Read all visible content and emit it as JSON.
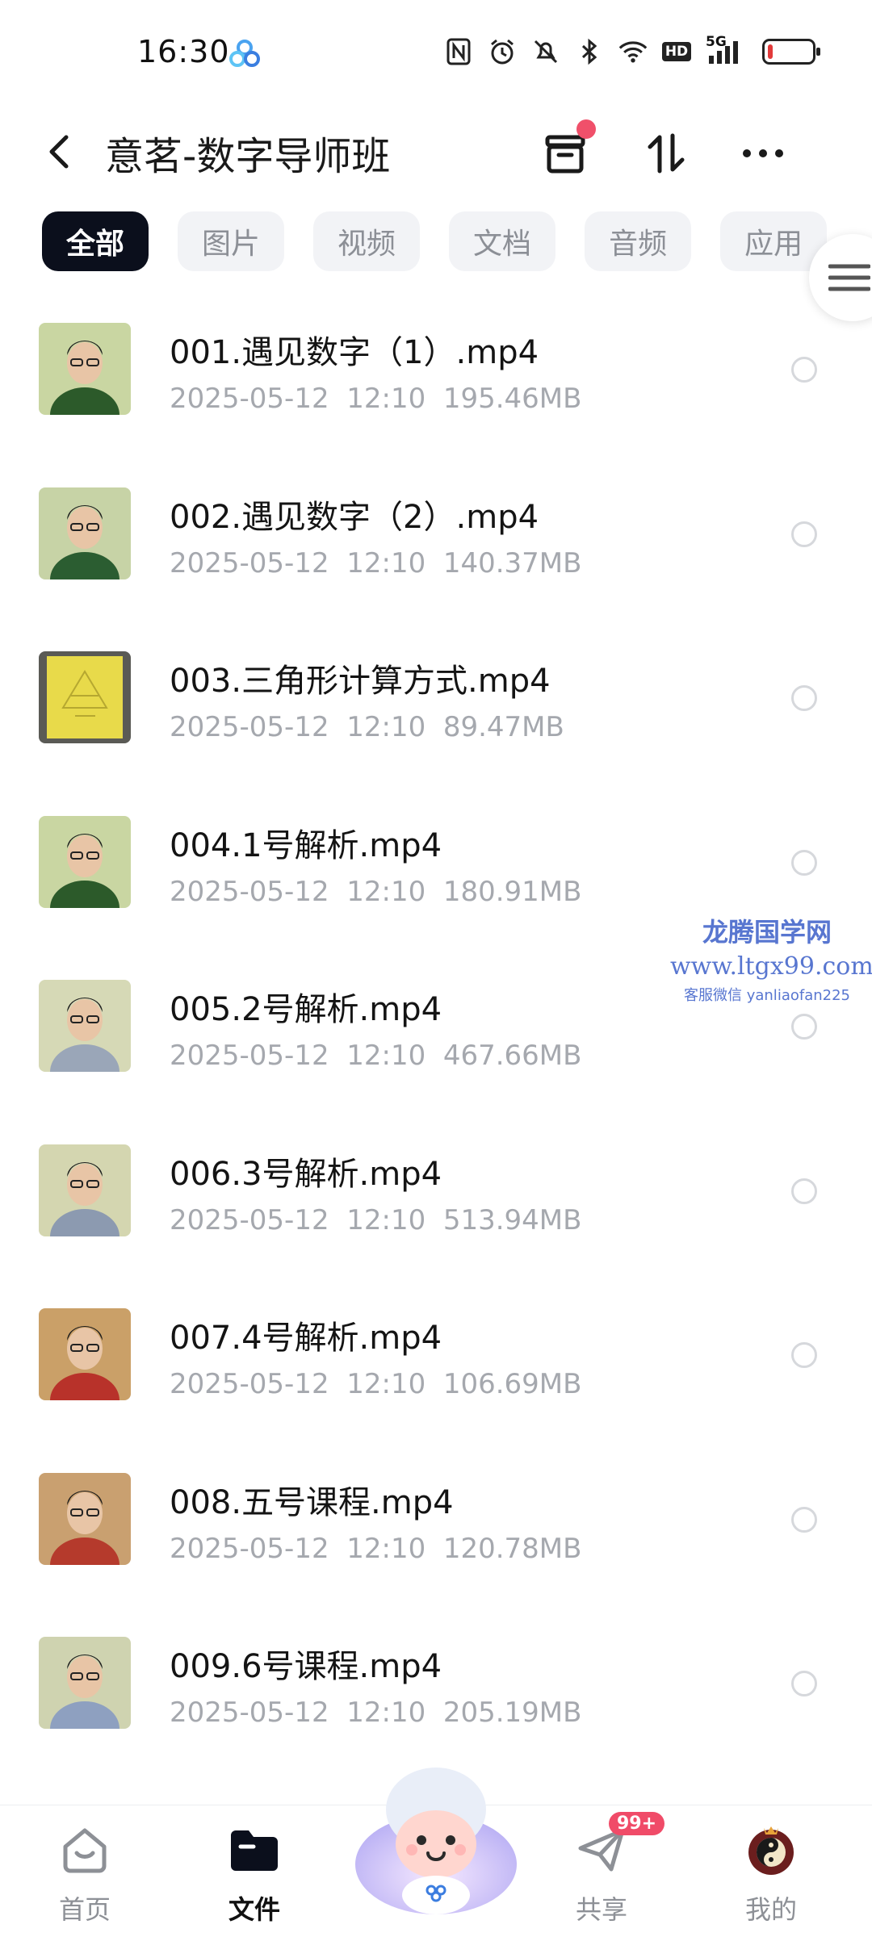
{
  "status_bar": {
    "time": "16:30",
    "icons": [
      "nfc-icon",
      "alarm-icon",
      "mute-icon",
      "bluetooth-icon",
      "wifi-icon",
      "hd-icon",
      "signal-5g-icon",
      "battery-icon"
    ],
    "hd_label": "HD",
    "net_label": "5G"
  },
  "header": {
    "title": "意茗-数字导师班"
  },
  "tabs": [
    {
      "label": "全部",
      "active": true
    },
    {
      "label": "图片",
      "active": false
    },
    {
      "label": "视频",
      "active": false
    },
    {
      "label": "文档",
      "active": false
    },
    {
      "label": "音频",
      "active": false
    },
    {
      "label": "应用",
      "active": false
    }
  ],
  "files": [
    {
      "name": "001.遇见数字（1）.mp4",
      "date": "2025-05-12",
      "time": "12:10",
      "size": "195.46MB"
    },
    {
      "name": "002.遇见数字（2）.mp4",
      "date": "2025-05-12",
      "time": "12:10",
      "size": "140.37MB"
    },
    {
      "name": "003.三角形计算方式.mp4",
      "date": "2025-05-12",
      "time": "12:10",
      "size": "89.47MB"
    },
    {
      "name": "004.1号解析.mp4",
      "date": "2025-05-12",
      "time": "12:10",
      "size": "180.91MB"
    },
    {
      "name": "005.2号解析.mp4",
      "date": "2025-05-12",
      "time": "12:10",
      "size": "467.66MB"
    },
    {
      "name": "006.3号解析.mp4",
      "date": "2025-05-12",
      "time": "12:10",
      "size": "513.94MB"
    },
    {
      "name": "007.4号解析.mp4",
      "date": "2025-05-12",
      "time": "12:10",
      "size": "106.69MB"
    },
    {
      "name": "008.五号课程.mp4",
      "date": "2025-05-12",
      "time": "12:10",
      "size": "120.78MB"
    },
    {
      "name": "009.6号课程.mp4",
      "date": "2025-05-12",
      "time": "12:10",
      "size": "205.19MB"
    }
  ],
  "watermark": {
    "line1": "龙腾国学网",
    "line2": "www.ltgx99.com",
    "line3": "客服微信 yanliaofan225"
  },
  "bottom_nav": {
    "home": "首页",
    "files": "文件",
    "share": "共享",
    "share_badge": "99+",
    "mine": "我的"
  },
  "colors": {
    "accent_dark": "#0b0f1c",
    "badge_red": "#f04b68",
    "muted_text": "#a5a8ae"
  }
}
